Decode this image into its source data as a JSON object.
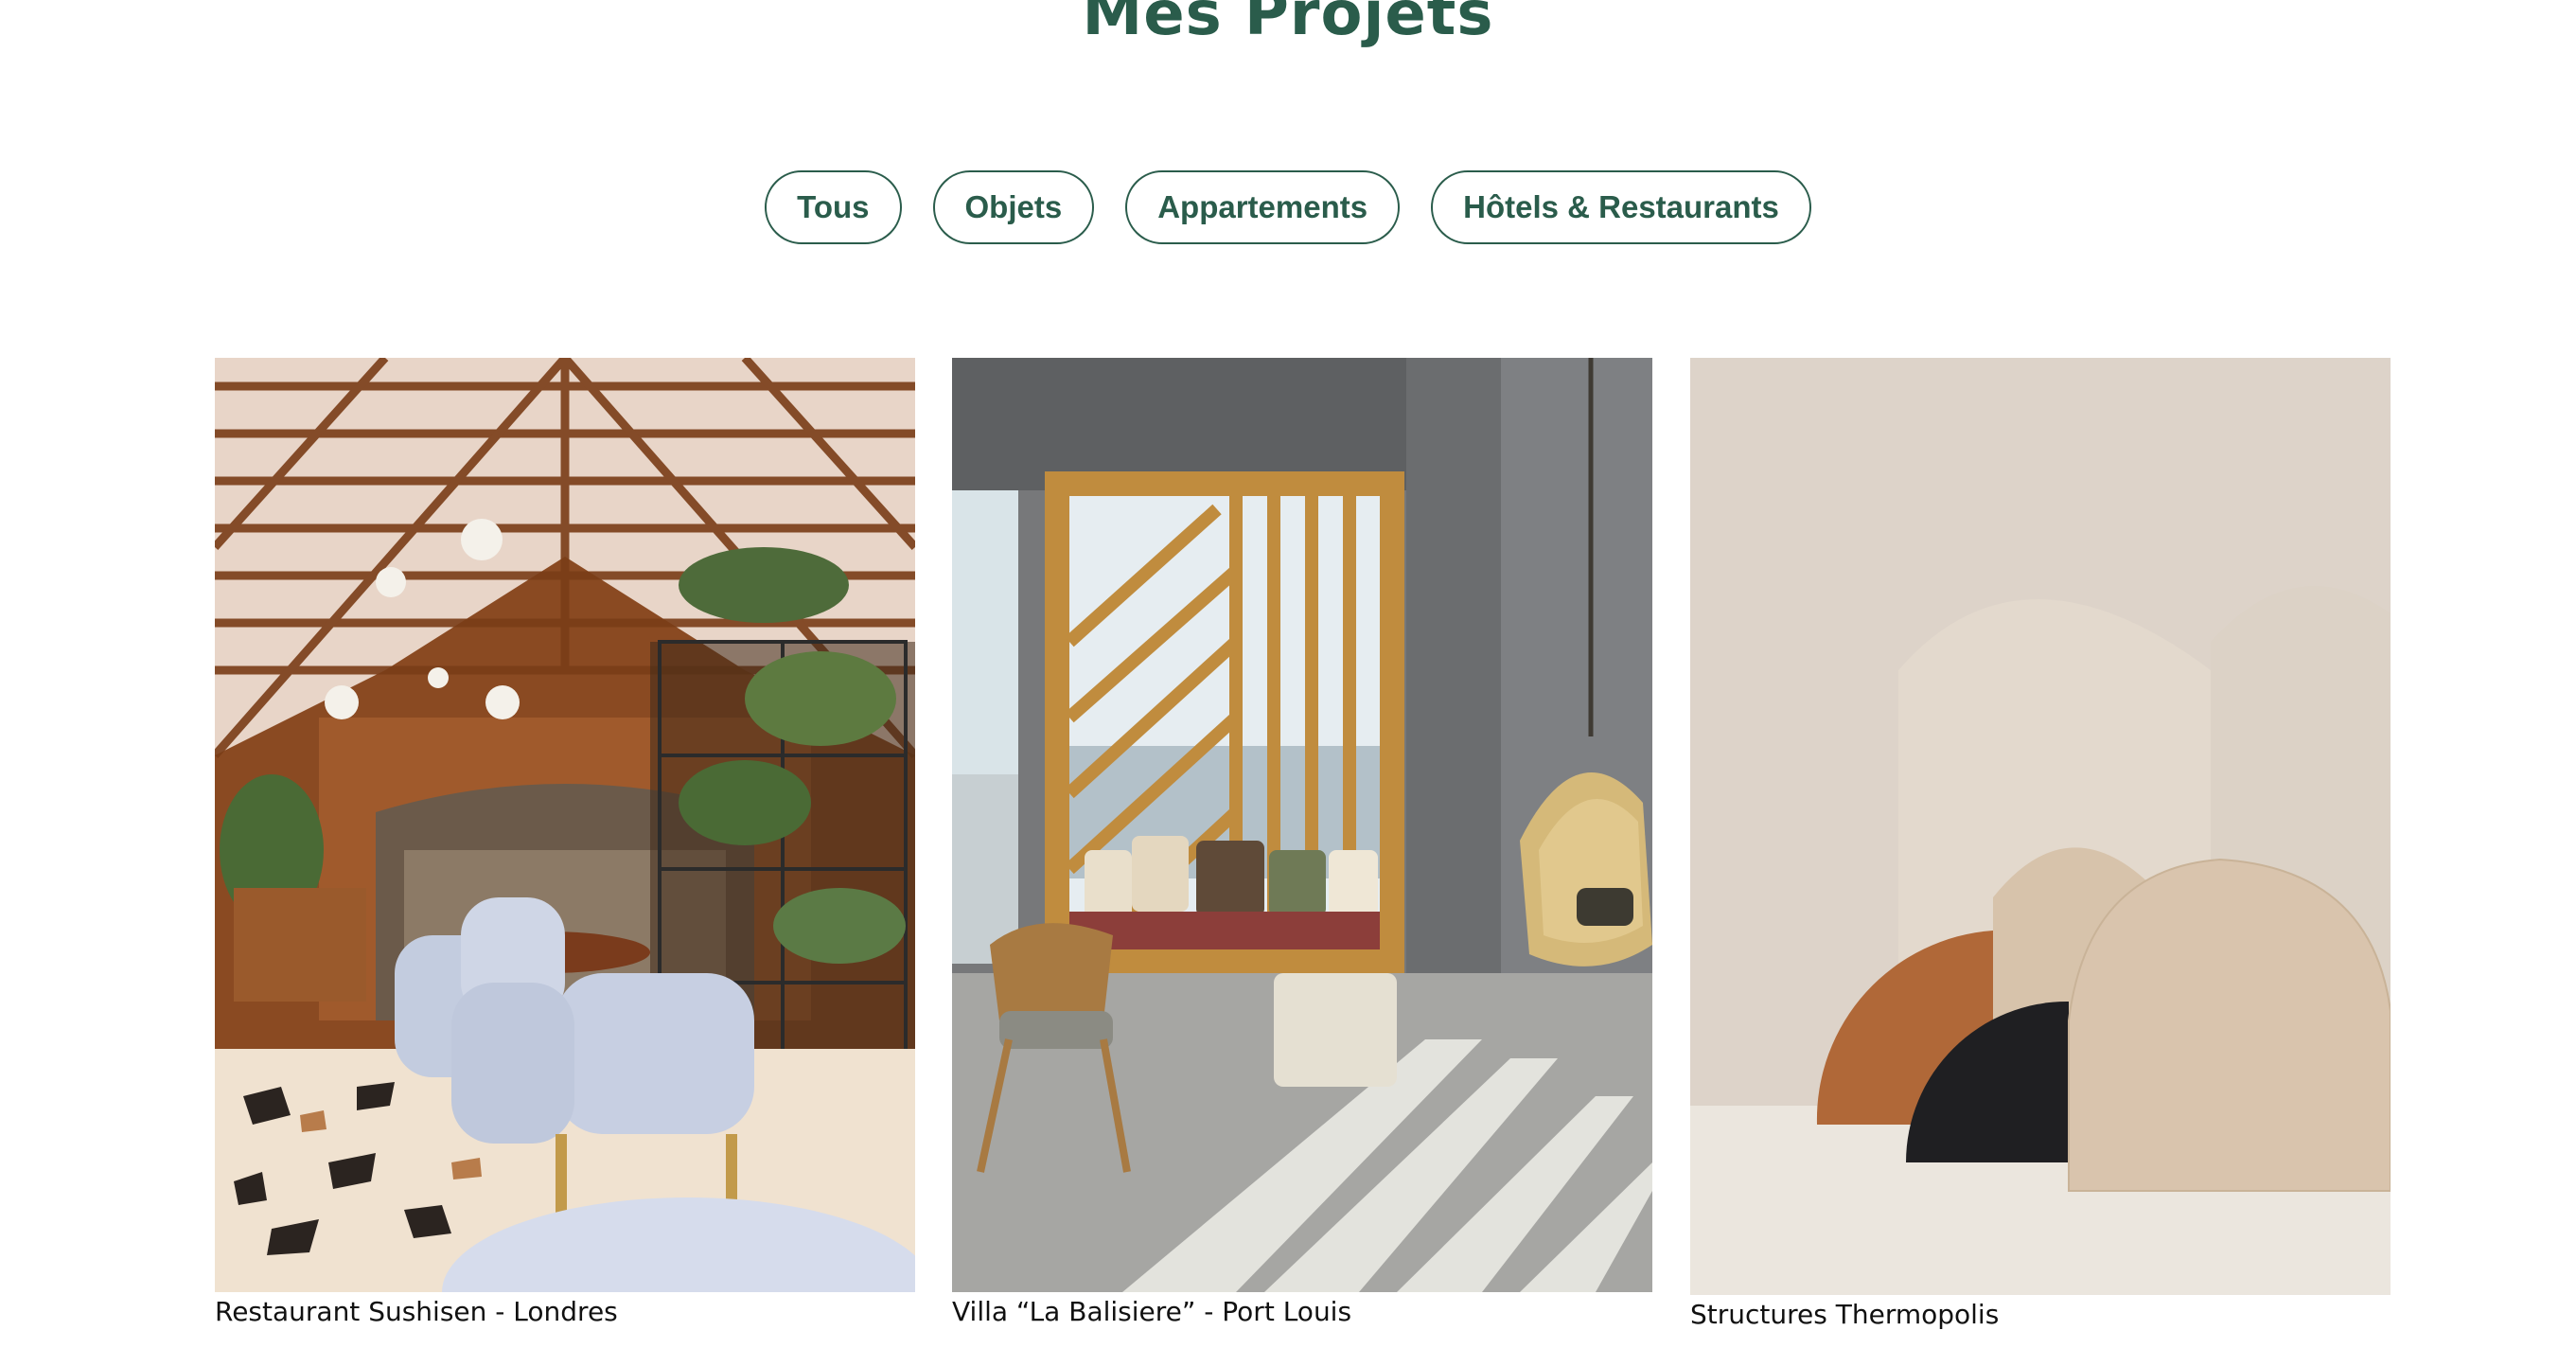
{
  "page": {
    "title": "Mes Projets"
  },
  "filters": [
    {
      "label": "Tous"
    },
    {
      "label": "Objets"
    },
    {
      "label": "Appartements"
    },
    {
      "label": "Hôtels & Restaurants"
    }
  ],
  "projects": [
    {
      "caption": "Restaurant Sushisen - Londres",
      "image": "restaurant-interior-photo"
    },
    {
      "caption": "Villa “La Balisiere” - Port Louis",
      "image": "villa-window-seat-photo"
    },
    {
      "caption": "Structures Thermopolis",
      "image": "arch-sculptures-photo"
    }
  ],
  "colors": {
    "accent": "#2a5c4b",
    "text": "#111111",
    "background": "#ffffff"
  }
}
